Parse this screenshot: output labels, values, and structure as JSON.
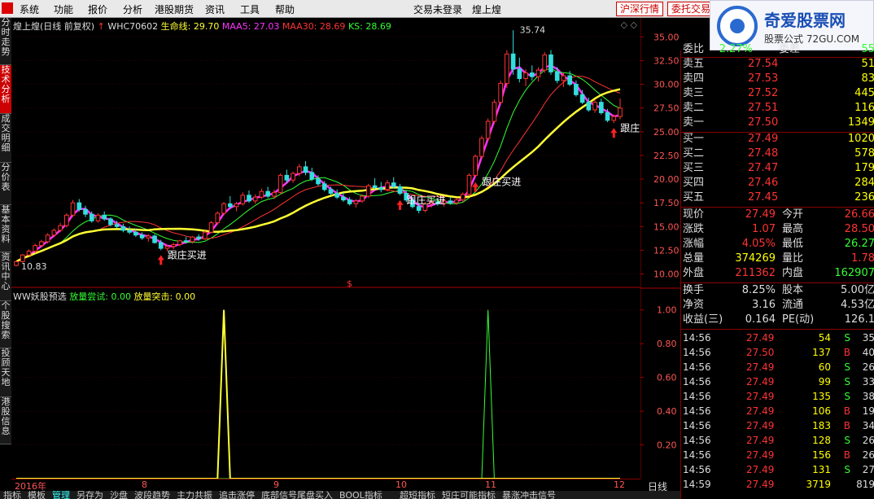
{
  "menubar": {
    "items": [
      "系统",
      "功能",
      "报价",
      "分析",
      "港股期货",
      "资讯",
      "工具",
      "帮助"
    ],
    "center_text": "交易未登录",
    "stock_name": "煌上煌",
    "btn_hs": "沪深行情",
    "btn_trade": "委托交易"
  },
  "watermark": {
    "title": "奇爱股票网",
    "sub": "股票公式 72GU.COM"
  },
  "sidebar": {
    "tabs": [
      "分时走势",
      "技术分析",
      "成交明细",
      "分价表",
      "基本资料",
      "资讯中心",
      "个股搜索",
      "投顾天地",
      "港股信息"
    ]
  },
  "top_info": {
    "name": "煌上煌(日线 前复权)",
    "code": "WHC70602",
    "smx": "生命线: 29.70",
    "maa5": "MAA5: 27.03",
    "maa30": "MAA30: 28.69",
    "ks": "KS: 28.69",
    "high_label": "35.74",
    "low_label": "10.83",
    "signal_label": "跟庄买进"
  },
  "bottom_info": {
    "name": "WW妖股预选",
    "s1": "放量尝试: 0.00",
    "s2": "放量突击: 0.00"
  },
  "axis": {
    "top": [
      "35.00",
      "32.50",
      "30.00",
      "27.50",
      "25.00",
      "22.50",
      "20.00",
      "17.50",
      "15.00",
      "12.50",
      "10.00"
    ],
    "bottom": [
      "1.00",
      "0.80",
      "0.60",
      "0.40",
      "0.20"
    ],
    "period": "日线"
  },
  "dates": [
    "2016年",
    "8",
    "9",
    "10",
    "11",
    "12"
  ],
  "quote": {
    "weibi": {
      "label": "委比",
      "value": "2.27%",
      "label2": "委差",
      "value2": "55"
    },
    "asks": [
      {
        "label": "卖五",
        "price": "27.54",
        "vol": "51"
      },
      {
        "label": "卖四",
        "price": "27.53",
        "vol": "83"
      },
      {
        "label": "卖三",
        "price": "27.52",
        "vol": "445"
      },
      {
        "label": "卖二",
        "price": "27.51",
        "vol": "116"
      },
      {
        "label": "卖一",
        "price": "27.50",
        "vol": "1349"
      }
    ],
    "bids": [
      {
        "label": "买一",
        "price": "27.49",
        "vol": "1020"
      },
      {
        "label": "买二",
        "price": "27.48",
        "vol": "578"
      },
      {
        "label": "买三",
        "price": "27.47",
        "vol": "179"
      },
      {
        "label": "买四",
        "price": "27.46",
        "vol": "284"
      },
      {
        "label": "买五",
        "price": "27.45",
        "vol": "236"
      }
    ],
    "stats": [
      {
        "l1": "现价",
        "v1": "27.49",
        "c1": "#f33",
        "l2": "今开",
        "v2": "26.66",
        "c2": "#f33"
      },
      {
        "l1": "涨跌",
        "v1": "1.07",
        "c1": "#f33",
        "l2": "最高",
        "v2": "28.50",
        "c2": "#f33"
      },
      {
        "l1": "涨幅",
        "v1": "4.05%",
        "c1": "#f33",
        "l2": "最低",
        "v2": "26.27",
        "c2": "#3f3"
      },
      {
        "l1": "总量",
        "v1": "374269",
        "c1": "#ff0",
        "l2": "量比",
        "v2": "1.78",
        "c2": "#f33"
      },
      {
        "l1": "外盘",
        "v1": "211362",
        "c1": "#f33",
        "l2": "内盘",
        "v2": "162907",
        "c2": "#3f3"
      }
    ],
    "stats2": [
      {
        "l1": "换手",
        "v1": "8.25%",
        "c1": "#ddd",
        "l2": "股本",
        "v2": "5.00亿",
        "c2": "#ddd"
      },
      {
        "l1": "净资",
        "v1": "3.16",
        "c1": "#ddd",
        "l2": "流通",
        "v2": "4.53亿",
        "c2": "#ddd"
      },
      {
        "l1": "收益(三)",
        "v1": "0.164",
        "c1": "#ddd",
        "l2": "PE(动)",
        "v2": "126.1",
        "c2": "#ddd"
      }
    ]
  },
  "ticks": [
    {
      "t": "14:56",
      "p": "27.49",
      "v": "54",
      "bs": "S",
      "n": "35"
    },
    {
      "t": "14:56",
      "p": "27.50",
      "v": "137",
      "bs": "B",
      "n": "40"
    },
    {
      "t": "14:56",
      "p": "27.49",
      "v": "60",
      "bs": "S",
      "n": "26"
    },
    {
      "t": "14:56",
      "p": "27.49",
      "v": "99",
      "bs": "S",
      "n": "33"
    },
    {
      "t": "14:56",
      "p": "27.49",
      "v": "135",
      "bs": "S",
      "n": "38"
    },
    {
      "t": "14:56",
      "p": "27.49",
      "v": "106",
      "bs": "B",
      "n": "19"
    },
    {
      "t": "14:56",
      "p": "27.49",
      "v": "183",
      "bs": "B",
      "n": "34"
    },
    {
      "t": "14:56",
      "p": "27.49",
      "v": "128",
      "bs": "S",
      "n": "26"
    },
    {
      "t": "14:56",
      "p": "27.49",
      "v": "156",
      "bs": "B",
      "n": "26"
    },
    {
      "t": "14:56",
      "p": "27.49",
      "v": "131",
      "bs": "S",
      "n": "27"
    },
    {
      "t": "14:59",
      "p": "27.49",
      "v": "3719",
      "bs": "",
      "n": "819"
    }
  ],
  "tabs": [
    "指标",
    "模板",
    "管理",
    "另存为",
    "沙盘",
    "波段趋势",
    "主力共振",
    "追击涨停",
    "底部信号尾盘买入",
    "BOOL指标",
    "超短指标",
    "短庄可能指标",
    "暴涨冲击信号"
  ],
  "chart_data": [
    {
      "type": "candlestick",
      "title": "煌上煌(日线 前复权)",
      "ylim": [
        8.5,
        37
      ],
      "yticks": [
        35,
        32.5,
        30,
        27.5,
        25,
        22.5,
        20,
        17.5,
        15,
        12.5,
        10
      ],
      "x_labels": [
        "2016年",
        "8",
        "9",
        "10",
        "11",
        "12"
      ],
      "ohlc": [
        [
          10.9,
          11.4,
          10.8,
          11.3
        ],
        [
          11.3,
          12.1,
          11.2,
          12.0
        ],
        [
          12.0,
          12.6,
          11.9,
          12.4
        ],
        [
          12.4,
          13.2,
          12.2,
          13.0
        ],
        [
          13.0,
          13.6,
          12.8,
          13.4
        ],
        [
          13.4,
          14.3,
          13.2,
          14.1
        ],
        [
          14.1,
          14.8,
          13.9,
          14.6
        ],
        [
          14.6,
          15.4,
          14.4,
          15.1
        ],
        [
          15.1,
          16.4,
          14.9,
          16.2
        ],
        [
          16.2,
          17.8,
          16.0,
          17.5
        ],
        [
          17.5,
          17.9,
          16.6,
          16.8
        ],
        [
          16.8,
          17.2,
          16.0,
          16.3
        ],
        [
          16.3,
          16.6,
          15.4,
          15.6
        ],
        [
          15.6,
          16.4,
          15.4,
          16.2
        ],
        [
          16.2,
          16.6,
          15.6,
          15.8
        ],
        [
          15.8,
          16.0,
          15.0,
          15.2
        ],
        [
          15.2,
          15.6,
          14.8,
          15.0
        ],
        [
          15.0,
          15.3,
          14.4,
          14.6
        ],
        [
          14.6,
          15.0,
          14.2,
          14.4
        ],
        [
          14.4,
          14.8,
          13.9,
          14.1
        ],
        [
          14.1,
          14.4,
          13.6,
          13.8
        ],
        [
          13.8,
          14.2,
          13.4,
          14.0
        ],
        [
          14.0,
          14.2,
          13.2,
          13.3
        ],
        [
          13.3,
          13.6,
          12.5,
          12.7
        ],
        [
          12.7,
          13.1,
          12.4,
          12.9
        ],
        [
          12.9,
          13.3,
          12.6,
          13.1
        ],
        [
          13.1,
          13.6,
          12.9,
          13.5
        ],
        [
          13.5,
          13.9,
          13.2,
          13.4
        ],
        [
          13.4,
          14.0,
          13.2,
          13.9
        ],
        [
          13.9,
          14.2,
          13.5,
          13.7
        ],
        [
          13.7,
          14.6,
          13.6,
          14.4
        ],
        [
          14.4,
          15.6,
          14.3,
          15.4
        ],
        [
          15.4,
          16.6,
          15.2,
          16.4
        ],
        [
          16.4,
          17.6,
          16.2,
          17.4
        ],
        [
          17.4,
          18.2,
          16.9,
          17.1
        ],
        [
          17.1,
          17.6,
          16.6,
          17.4
        ],
        [
          17.4,
          18.6,
          17.2,
          18.3
        ],
        [
          18.3,
          18.8,
          17.5,
          17.7
        ],
        [
          17.7,
          18.4,
          17.4,
          18.1
        ],
        [
          18.1,
          19.0,
          17.9,
          18.7
        ],
        [
          18.7,
          19.2,
          18.0,
          18.2
        ],
        [
          18.2,
          18.9,
          17.9,
          18.6
        ],
        [
          18.6,
          20.6,
          18.4,
          20.4
        ],
        [
          20.4,
          21.0,
          19.6,
          19.9
        ],
        [
          19.9,
          20.8,
          19.6,
          20.6
        ],
        [
          20.6,
          21.6,
          20.3,
          21.3
        ],
        [
          21.3,
          21.9,
          20.4,
          20.7
        ],
        [
          20.7,
          21.2,
          19.8,
          20.0
        ],
        [
          20.0,
          20.4,
          19.3,
          19.5
        ],
        [
          19.5,
          19.8,
          18.7,
          18.9
        ],
        [
          18.9,
          19.2,
          18.3,
          18.5
        ],
        [
          18.5,
          18.9,
          17.9,
          18.1
        ],
        [
          18.1,
          18.6,
          17.6,
          17.8
        ],
        [
          17.8,
          18.1,
          17.2,
          17.4
        ],
        [
          17.4,
          17.9,
          17.0,
          17.7
        ],
        [
          17.7,
          18.4,
          17.5,
          18.2
        ],
        [
          18.2,
          19.5,
          18.0,
          19.3
        ],
        [
          19.3,
          20.1,
          18.9,
          19.1
        ],
        [
          19.1,
          19.7,
          18.6,
          18.9
        ],
        [
          18.9,
          19.9,
          18.7,
          19.6
        ],
        [
          19.6,
          20.2,
          19.0,
          19.2
        ],
        [
          19.2,
          19.5,
          18.3,
          18.5
        ],
        [
          18.5,
          18.8,
          17.6,
          17.8
        ],
        [
          17.8,
          18.1,
          16.9,
          17.1
        ],
        [
          17.1,
          17.5,
          16.4,
          16.7
        ],
        [
          16.7,
          17.6,
          16.5,
          17.4
        ],
        [
          17.4,
          17.9,
          17.0,
          17.6
        ],
        [
          17.6,
          18.0,
          17.2,
          17.4
        ],
        [
          17.4,
          17.9,
          17.1,
          17.7
        ],
        [
          17.7,
          18.1,
          17.3,
          17.5
        ],
        [
          17.5,
          18.0,
          17.3,
          17.8
        ],
        [
          17.8,
          18.6,
          17.6,
          18.4
        ],
        [
          18.4,
          20.6,
          18.2,
          20.4
        ],
        [
          20.4,
          22.6,
          20.2,
          22.4
        ],
        [
          22.4,
          24.6,
          22.1,
          24.3
        ],
        [
          24.3,
          26.4,
          24.0,
          26.1
        ],
        [
          26.1,
          28.4,
          25.8,
          28.1
        ],
        [
          28.1,
          30.4,
          27.9,
          30.1
        ],
        [
          30.1,
          33.6,
          29.6,
          33.2
        ],
        [
          33.2,
          35.7,
          31.0,
          31.6
        ],
        [
          31.6,
          32.8,
          30.2,
          30.6
        ],
        [
          30.6,
          31.6,
          29.8,
          31.2
        ],
        [
          31.2,
          32.0,
          30.4,
          30.8
        ],
        [
          30.8,
          31.8,
          30.3,
          31.5
        ],
        [
          31.5,
          33.4,
          31.2,
          33.1
        ],
        [
          33.1,
          33.6,
          31.0,
          31.3
        ],
        [
          31.3,
          31.8,
          30.1,
          30.4
        ],
        [
          30.4,
          31.2,
          29.7,
          30.9
        ],
        [
          30.9,
          31.4,
          29.8,
          30.0
        ],
        [
          30.0,
          30.4,
          28.7,
          28.9
        ],
        [
          28.9,
          29.4,
          27.9,
          28.1
        ],
        [
          28.1,
          28.6,
          27.1,
          27.3
        ],
        [
          27.3,
          28.4,
          27.0,
          28.1
        ],
        [
          28.1,
          28.5,
          26.8,
          27.0
        ],
        [
          27.0,
          27.4,
          26.0,
          26.2
        ],
        [
          26.2,
          26.8,
          25.9,
          26.6
        ],
        [
          26.6,
          28.5,
          26.3,
          27.49
        ]
      ],
      "series": [
        {
          "name": "生命线",
          "color": "#ffff33"
        },
        {
          "name": "MAA5",
          "color": "#ff33ff"
        },
        {
          "name": "MAA30",
          "color": "#ff3333"
        },
        {
          "name": "KS",
          "color": "#33ff33"
        }
      ],
      "annotations": {
        "high": 35.74,
        "low": 10.83,
        "buy_signal_indices": [
          23,
          61,
          73,
          95
        ]
      }
    },
    {
      "type": "line",
      "title": "WW妖股预选",
      "ylim": [
        0,
        1.1
      ],
      "yticks": [
        1.0,
        0.8,
        0.6,
        0.4,
        0.2
      ],
      "series": [
        {
          "name": "放量尝试",
          "color": "#33ff33",
          "spike_index": 75,
          "value": 1.0
        },
        {
          "name": "放量突击",
          "color": "#ffff33",
          "spike_index": 33,
          "value": 1.0
        }
      ]
    }
  ]
}
